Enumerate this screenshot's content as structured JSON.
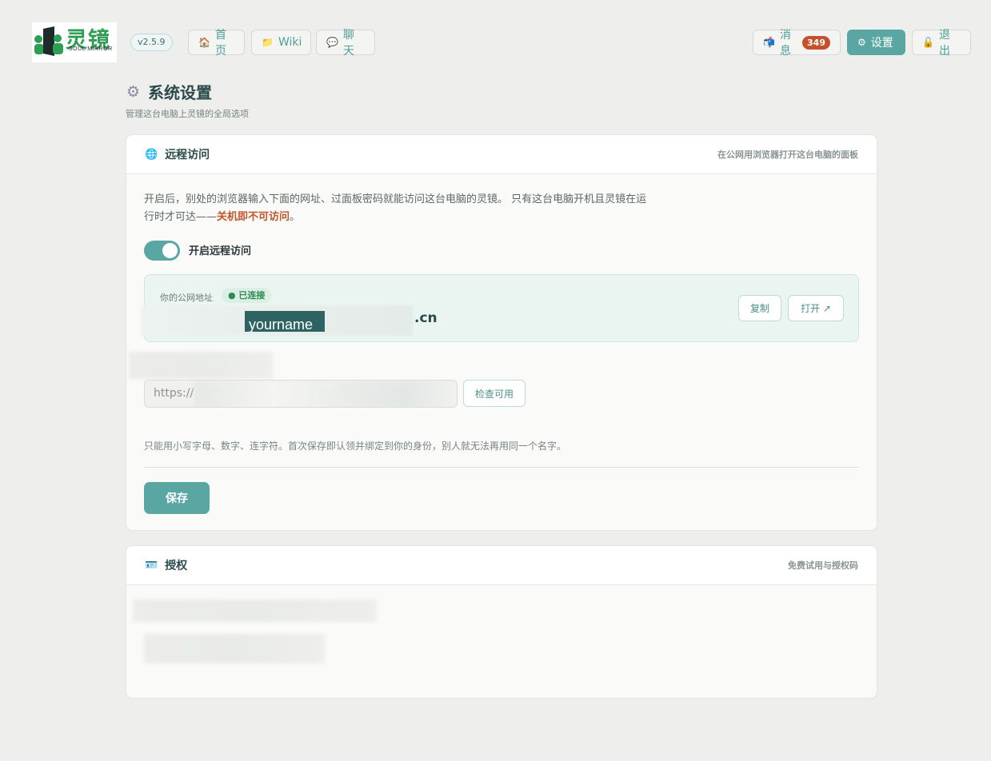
{
  "header": {
    "logo": {
      "cn": "灵镜",
      "en": "SOUL MIRROR",
      "brand_color": "#2f9e55"
    },
    "version": "v2.5.9",
    "nav": [
      {
        "icon": "home-icon",
        "label": "首页"
      },
      {
        "icon": "folder-icon",
        "label": "Wiki"
      },
      {
        "icon": "chat-bubble-icon",
        "label": "聊天"
      }
    ],
    "messages": {
      "icon": "mailbox-icon",
      "label": "消息",
      "count": "349"
    },
    "settings": {
      "icon": "gear-icon",
      "label": "设置"
    },
    "logout": {
      "icon": "unlock-icon",
      "label": "退出"
    }
  },
  "page": {
    "icon": "gear-icon",
    "title": "系统设置",
    "subtitle": "管理这台电脑上灵镜的全局选项"
  },
  "remote_access": {
    "icon": "globe-icon",
    "title": "远程访问",
    "hint": "在公网用浏览器打开这台电脑的面板",
    "description": "开启后，别处的浏览器输入下面的网址、过面板密码就能访问这台电脑的灵镜。 只有这台电脑开机且灵镜在运行时才可达——",
    "warning": "关机即不可访问",
    "description_end": "。",
    "toggle_label": "开启远程访问",
    "toggle_on": true,
    "address_label": "你的公网地址",
    "status": "● 已连接",
    "address_name": "yourname",
    "address_suffix": ".cn",
    "copy_button": "复制",
    "open_button": "打开 ↗",
    "url_prefix": "https://",
    "check_button": "检查可用",
    "rule_text": "只能用小写字母、数字、连字符。首次保存即认领并绑定到你的身份，别人就无法再用同一个名字。",
    "save_button": "保存",
    "accent_color": "#5aa6a3",
    "warning_color": "#c0562a"
  },
  "license": {
    "icon": "id-card-icon",
    "title": "授权",
    "hint": "免费试用与授权码"
  }
}
